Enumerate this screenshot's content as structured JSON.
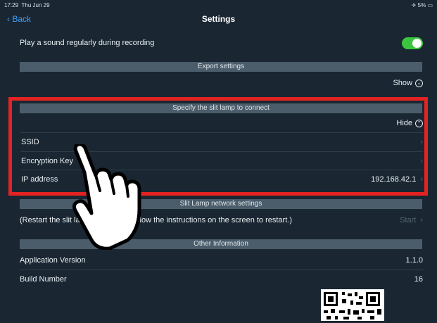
{
  "status_bar": {
    "time": "17:29",
    "date": "Thu Jun 29",
    "battery": "5%"
  },
  "nav": {
    "back_label": "Back",
    "title": "Settings"
  },
  "rows": {
    "sound_label": "Play a sound regularly during recording",
    "export_header": "Export settings",
    "export_toggle": "Show",
    "slit_header": "Specify the slit lamp to connect",
    "slit_toggle": "Hide",
    "ssid_label": "SSID",
    "enc_label": "Encryption Key",
    "ip_label": "IP address",
    "ip_value": "192.168.42.1",
    "net_header": "Slit Lamp network settings",
    "restart_text": "(Restart the slit la            etting. Follow the instructions on the screen to restart.)",
    "start_label": "Start",
    "info_header": "Other Information",
    "app_ver_label": "Application Version",
    "app_ver_value": "1.1.0",
    "build_label": "Build Number",
    "build_value": "16"
  },
  "colors": {
    "accent": "#3aa0ff",
    "toggle_on": "#3cc63f",
    "highlight": "#e52222"
  }
}
